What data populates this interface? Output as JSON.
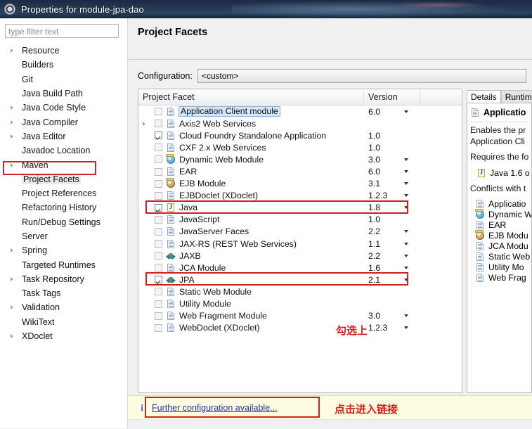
{
  "window": {
    "title": "Properties for module-jpa-dao",
    "icon": "properties-gear-icon"
  },
  "sidebar": {
    "filter": {
      "placeholder": "type filter text",
      "value": ""
    },
    "items": [
      {
        "label": "Resource",
        "expandable": true,
        "selected": false
      },
      {
        "label": "Builders",
        "expandable": false,
        "selected": false
      },
      {
        "label": "Git",
        "expandable": false,
        "selected": false
      },
      {
        "label": "Java Build Path",
        "expandable": false,
        "selected": false
      },
      {
        "label": "Java Code Style",
        "expandable": true,
        "selected": false
      },
      {
        "label": "Java Compiler",
        "expandable": true,
        "selected": false
      },
      {
        "label": "Java Editor",
        "expandable": true,
        "selected": false
      },
      {
        "label": "Javadoc Location",
        "expandable": false,
        "selected": false
      },
      {
        "label": "Maven",
        "expandable": true,
        "selected": false
      },
      {
        "label": "Project Facets",
        "expandable": false,
        "selected": true
      },
      {
        "label": "Project References",
        "expandable": false,
        "selected": false
      },
      {
        "label": "Refactoring History",
        "expandable": false,
        "selected": false
      },
      {
        "label": "Run/Debug Settings",
        "expandable": false,
        "selected": false
      },
      {
        "label": "Server",
        "expandable": false,
        "selected": false
      },
      {
        "label": "Spring",
        "expandable": true,
        "selected": false
      },
      {
        "label": "Targeted Runtimes",
        "expandable": false,
        "selected": false
      },
      {
        "label": "Task Repository",
        "expandable": true,
        "selected": false
      },
      {
        "label": "Task Tags",
        "expandable": false,
        "selected": false
      },
      {
        "label": "Validation",
        "expandable": true,
        "selected": false
      },
      {
        "label": "WikiText",
        "expandable": false,
        "selected": false
      },
      {
        "label": "XDoclet",
        "expandable": true,
        "selected": false
      }
    ]
  },
  "page": {
    "title": "Project Facets",
    "configuration_label": "Configuration:",
    "configuration_value": "<custom>"
  },
  "facet_table": {
    "columns": [
      "Project Facet",
      "Version"
    ],
    "rows": [
      {
        "name": "Application Client module",
        "version": "6.0",
        "checked": false,
        "icon": "doc-icon",
        "expandable": false,
        "caret": true,
        "selected": true,
        "highlight": false
      },
      {
        "name": "Axis2 Web Services",
        "version": "",
        "checked": false,
        "icon": "doc-icon",
        "expandable": true,
        "caret": false,
        "selected": false,
        "highlight": false
      },
      {
        "name": "Cloud Foundry Standalone Application",
        "version": "1.0",
        "checked": true,
        "icon": "doc-icon",
        "expandable": false,
        "caret": false,
        "selected": false,
        "highlight": false
      },
      {
        "name": "CXF 2.x Web Services",
        "version": "1.0",
        "checked": false,
        "icon": "doc-icon",
        "expandable": false,
        "caret": false,
        "selected": false,
        "highlight": false
      },
      {
        "name": "Dynamic Web Module",
        "version": "3.0",
        "checked": false,
        "icon": "web-module-icon",
        "expandable": false,
        "caret": true,
        "selected": false,
        "highlight": false
      },
      {
        "name": "EAR",
        "version": "6.0",
        "checked": false,
        "icon": "doc-icon",
        "expandable": false,
        "caret": true,
        "selected": false,
        "highlight": false
      },
      {
        "name": "EJB Module",
        "version": "3.1",
        "checked": false,
        "icon": "ejb-icon",
        "expandable": false,
        "caret": true,
        "selected": false,
        "highlight": false
      },
      {
        "name": "EJBDoclet (XDoclet)",
        "version": "1.2.3",
        "checked": false,
        "icon": "doc-icon",
        "expandable": false,
        "caret": true,
        "selected": false,
        "highlight": false
      },
      {
        "name": "Java",
        "version": "1.8",
        "checked": true,
        "icon": "java-icon",
        "expandable": false,
        "caret": true,
        "selected": false,
        "highlight": true
      },
      {
        "name": "JavaScript",
        "version": "1.0",
        "checked": false,
        "icon": "doc-icon",
        "expandable": false,
        "caret": false,
        "selected": false,
        "highlight": false
      },
      {
        "name": "JavaServer Faces",
        "version": "2.2",
        "checked": false,
        "icon": "doc-icon",
        "expandable": false,
        "caret": true,
        "selected": false,
        "highlight": false
      },
      {
        "name": "JAX-RS (REST Web Services)",
        "version": "1.1",
        "checked": false,
        "icon": "doc-icon",
        "expandable": false,
        "caret": true,
        "selected": false,
        "highlight": false
      },
      {
        "name": "JAXB",
        "version": "2.2",
        "checked": false,
        "icon": "arrows-icon",
        "expandable": false,
        "caret": true,
        "selected": false,
        "highlight": false
      },
      {
        "name": "JCA Module",
        "version": "1.6",
        "checked": false,
        "icon": "doc-icon",
        "expandable": false,
        "caret": true,
        "selected": false,
        "highlight": false
      },
      {
        "name": "JPA",
        "version": "2.1",
        "checked": true,
        "icon": "arrows-icon",
        "expandable": false,
        "caret": true,
        "selected": false,
        "highlight": true
      },
      {
        "name": "Static Web Module",
        "version": "",
        "checked": false,
        "icon": "doc-icon",
        "expandable": false,
        "caret": false,
        "selected": false,
        "highlight": false
      },
      {
        "name": "Utility Module",
        "version": "",
        "checked": false,
        "icon": "doc-icon",
        "expandable": false,
        "caret": false,
        "selected": false,
        "highlight": false
      },
      {
        "name": "Web Fragment Module",
        "version": "3.0",
        "checked": false,
        "icon": "doc-icon",
        "expandable": false,
        "caret": true,
        "selected": false,
        "highlight": false
      },
      {
        "name": "WebDoclet (XDoclet)",
        "version": "1.2.3",
        "checked": false,
        "icon": "doc-icon",
        "expandable": false,
        "caret": true,
        "selected": false,
        "highlight": false
      }
    ]
  },
  "details": {
    "tabs": [
      {
        "label": "Details",
        "active": true
      },
      {
        "label": "Runtim",
        "active": false
      }
    ],
    "heading": "Applicatio",
    "heading_icon": "doc-icon",
    "paragraph_1_line_1": "Enables the pr",
    "paragraph_1_line_2": "Application Cli",
    "requires_label": "Requires the fo",
    "requires_item": "Java 1.6 o",
    "requires_item_icon": "java-icon",
    "conflicts_label": "Conflicts with t",
    "conflicts": [
      {
        "label": "Applicatio",
        "icon": "doc-icon"
      },
      {
        "label": "Dynamic W",
        "icon": "web-module-icon"
      },
      {
        "label": "EAR",
        "icon": "doc-icon"
      },
      {
        "label": "EJB Modu",
        "icon": "ejb-icon"
      },
      {
        "label": "JCA Modu",
        "icon": "doc-icon"
      },
      {
        "label": "Static Web",
        "icon": "doc-icon"
      },
      {
        "label": "Utility Mo",
        "icon": "doc-icon"
      },
      {
        "label": "Web Frag",
        "icon": "doc-icon"
      }
    ]
  },
  "footer": {
    "info_icon": "info-icon",
    "link": "Further configuration available..."
  },
  "annotations": {
    "check_these": "勾选上",
    "click_link": "点击进入链接",
    "color": "#cc2222"
  }
}
